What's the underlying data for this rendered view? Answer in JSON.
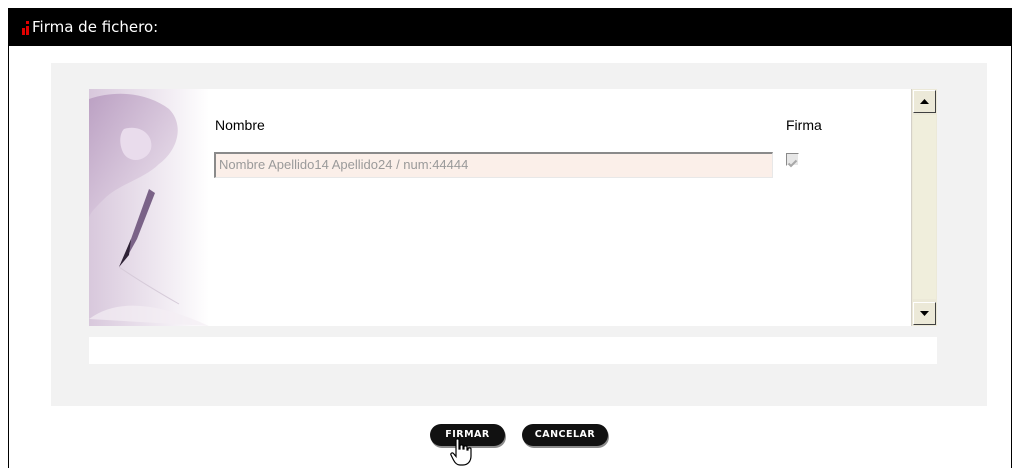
{
  "window": {
    "title": "Firma de fichero:",
    "marker_color": "#e10000"
  },
  "form": {
    "column_name_label": "Nombre",
    "column_sign_label": "Firma",
    "rows": [
      {
        "name": "Nombre Apellido14 Apellido24 / num:44444",
        "signed": true
      }
    ]
  },
  "buttons": {
    "sign_label": "FIRMAR",
    "cancel_label": "CANCELAR"
  },
  "icons": {
    "pen": "pen-writing-icon",
    "scroll_up": "scroll-up-arrow-icon",
    "scroll_down": "scroll-down-arrow-icon",
    "cursor": "hand-pointer-icon"
  },
  "colors": {
    "titlebar": "#000000",
    "panel": "#f2f2f2",
    "field_background": "#fbefe9",
    "button": "#111111"
  }
}
